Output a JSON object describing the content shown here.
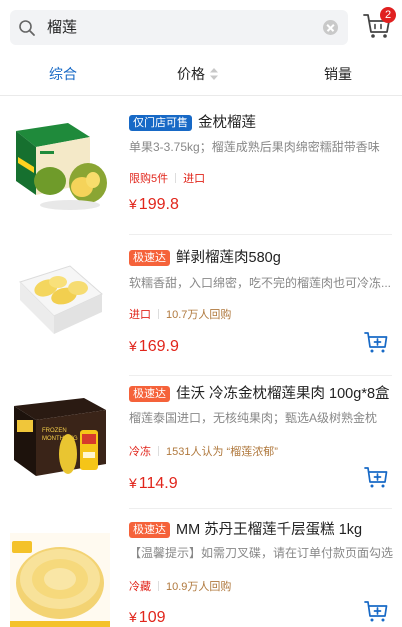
{
  "search": {
    "query": "榴莲"
  },
  "cart": {
    "badge": "2"
  },
  "sort_tabs": [
    {
      "label": "综合",
      "active": true
    },
    {
      "label": "价格",
      "active": false
    },
    {
      "label": "销量",
      "active": false
    }
  ],
  "products": [
    {
      "tag": "仅门店可售",
      "tag_color": "#1769c6",
      "title": "金枕榴莲",
      "desc": "单果3-3.75kg；榴莲成熟后果肉绵密糯甜带香味",
      "meta_primary": "限购5件",
      "meta_secondary": "进口",
      "price_symbol": "¥",
      "price": "199.8",
      "image": "durian-gift-box"
    },
    {
      "tag": "极速达",
      "tag_color": "#f5623a",
      "title": "鲜剥榴莲肉580g",
      "desc": "软糯香甜，入口绵密，吃不完的榴莲肉也可冷冻...",
      "meta_primary": "进口",
      "meta_secondary": "10.7万人回购",
      "price_symbol": "¥",
      "price": "169.9",
      "image": "durian-flesh-box"
    },
    {
      "tag": "极速达",
      "tag_color": "#f5623a",
      "title": "佳沃 冷冻金枕榴莲果肉 100g*8盒",
      "desc": "榴莲泰国进口，无核纯果肉；甄选A级树熟金枕",
      "meta_primary": "冷冻",
      "meta_secondary": "1531人认为 “榴莲浓郁”",
      "price_symbol": "¥",
      "price": "114.9",
      "image": "frozen-durian-package"
    },
    {
      "tag": "极速达",
      "tag_color": "#f5623a",
      "title": "MM 苏丹王榴莲千层蛋糕 1kg",
      "desc": "【温馨提示】如需刀叉碟，请在订单付款页面勾选",
      "meta_primary": "冷藏",
      "meta_secondary": "10.9万人回购",
      "price_symbol": "¥",
      "price": "109",
      "image": "durian-crepe-cake"
    }
  ]
}
